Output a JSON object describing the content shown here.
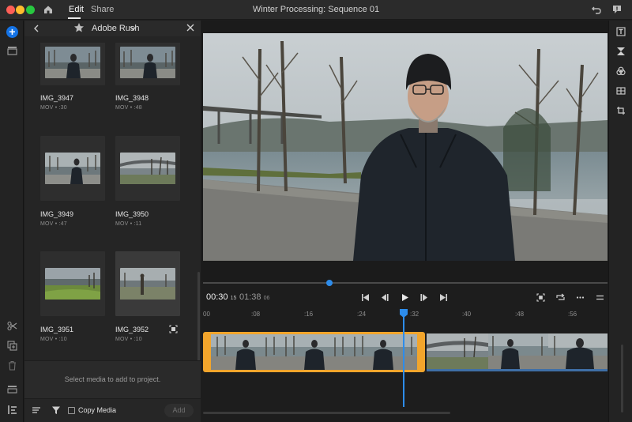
{
  "window": {
    "title": "Winter Processing: Sequence 01",
    "tabs": [
      {
        "label": "Edit",
        "active": true
      },
      {
        "label": "Share",
        "active": false
      }
    ]
  },
  "media_panel": {
    "location": "Adobe Rush",
    "items": [
      {
        "name": "IMG_3947",
        "meta": "MOV • :30"
      },
      {
        "name": "IMG_3948",
        "meta": "MOV • :48"
      },
      {
        "name": "IMG_3949",
        "meta": "MOV • :47"
      },
      {
        "name": "IMG_3950",
        "meta": "MOV • :11"
      },
      {
        "name": "IMG_3951",
        "meta": "MOV • :10"
      },
      {
        "name": "IMG_3952",
        "meta": "MOV • :10"
      }
    ],
    "select_message": "Select media to add to project.",
    "copy_media_label": "Copy Media",
    "copy_media_checked": false,
    "add_button_label": "Add"
  },
  "transport": {
    "current_time": "00:30",
    "current_frames": "15",
    "duration": "01:38",
    "duration_frames": "06",
    "scrub_progress": 0.31
  },
  "timeline": {
    "ruler_labels": [
      "00",
      ":08",
      ":16",
      ":24",
      ":32",
      ":40",
      ":48",
      ":56"
    ],
    "playhead_time": ":31"
  },
  "icons": {
    "home": "home-icon",
    "undo": "undo-icon",
    "feedback": "feedback-icon",
    "star": "star-icon",
    "split": "scissors-icon",
    "duplicate": "duplicate-icon",
    "delete": "trash-icon"
  },
  "colors": {
    "accent": "#1473e6",
    "playhead": "#2d8ceb",
    "selected_clip": "#f2a52c"
  }
}
